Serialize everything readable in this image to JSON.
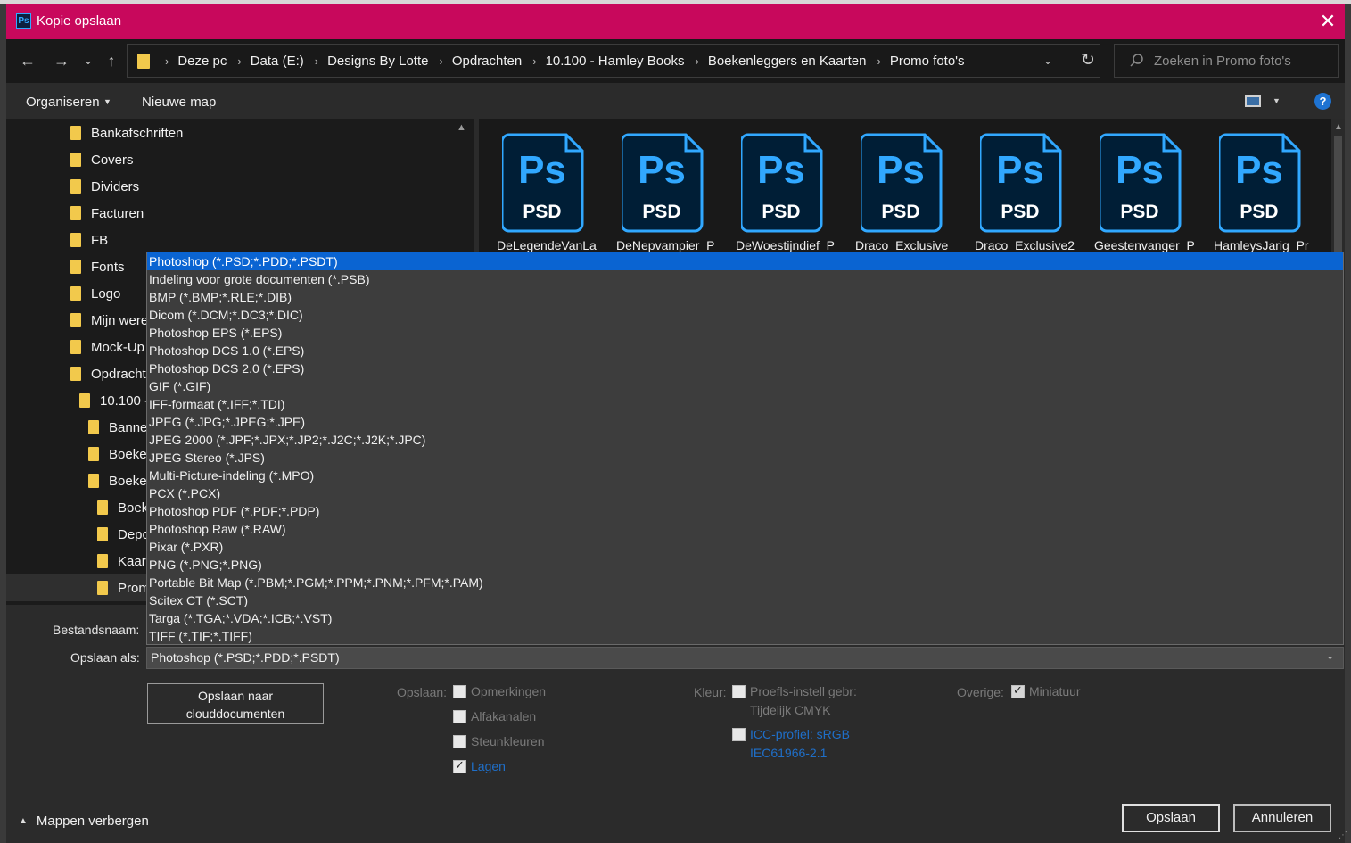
{
  "window": {
    "title": "Kopie opslaan",
    "app_badge": "Ps",
    "close_glyph": "✕"
  },
  "nav": {
    "back_glyph": "←",
    "forward_glyph": "→",
    "recent_glyph": "⌄",
    "up_glyph": "↑",
    "breadcrumbs": [
      "Deze pc",
      "Data (E:)",
      "Designs By Lotte",
      "Opdrachten",
      "10.100 - Hamley Books",
      "Boekenleggers en Kaarten",
      "Promo foto's"
    ],
    "separator": "›",
    "refresh_glyph": "↻",
    "dropdown_glyph": "⌄"
  },
  "search": {
    "placeholder": "Zoeken in Promo foto's"
  },
  "toolbar": {
    "organize_label": "Organiseren",
    "new_folder_label": "Nieuwe map",
    "help_label": "?"
  },
  "sidebar": {
    "items": [
      {
        "label": "Bankafschriften",
        "indent": 0
      },
      {
        "label": "Covers",
        "indent": 0
      },
      {
        "label": "Dividers",
        "indent": 0
      },
      {
        "label": "Facturen",
        "indent": 0
      },
      {
        "label": "FB",
        "indent": 0
      },
      {
        "label": "Fonts",
        "indent": 0
      },
      {
        "label": "Logo",
        "indent": 0
      },
      {
        "label": "Mijn were",
        "indent": 0
      },
      {
        "label": "Mock-Up",
        "indent": 0
      },
      {
        "label": "Opdracht",
        "indent": 0
      },
      {
        "label": "10.100 -",
        "indent": 1
      },
      {
        "label": "Banne",
        "indent": 2
      },
      {
        "label": "Boeke",
        "indent": 2
      },
      {
        "label": "Boeke",
        "indent": 2
      },
      {
        "label": "Boek",
        "indent": 3
      },
      {
        "label": "Depo",
        "indent": 3
      },
      {
        "label": "Kaar",
        "indent": 3
      },
      {
        "label": "Prom",
        "indent": 3,
        "selected": true
      }
    ]
  },
  "files": [
    {
      "name": "DeLegendeVanLa",
      "type_label": "PSD",
      "icon_text": "Ps"
    },
    {
      "name": "DeNepvampier_P",
      "type_label": "PSD",
      "icon_text": "Ps"
    },
    {
      "name": "DeWoestijndief_P",
      "type_label": "PSD",
      "icon_text": "Ps"
    },
    {
      "name": "Draco_Exclusive",
      "type_label": "PSD",
      "icon_text": "Ps"
    },
    {
      "name": "Draco_Exclusive2",
      "type_label": "PSD",
      "icon_text": "Ps"
    },
    {
      "name": "Geestenvanger_P",
      "type_label": "PSD",
      "icon_text": "Ps"
    },
    {
      "name": "HamleysJarig_Pr",
      "type_label": "PSD",
      "icon_text": "Ps"
    }
  ],
  "form": {
    "filename_label": "Bestandsnaam:",
    "saveas_label": "Opslaan als:",
    "saveas_value": "Photoshop (*.PSD;*.PDD;*.PSDT)",
    "format_options": [
      "Photoshop (*.PSD;*.PDD;*.PSDT)",
      "Indeling voor grote documenten (*.PSB)",
      "BMP (*.BMP;*.RLE;*.DIB)",
      "Dicom (*.DCM;*.DC3;*.DIC)",
      "Photoshop EPS (*.EPS)",
      "Photoshop DCS 1.0 (*.EPS)",
      "Photoshop DCS 2.0 (*.EPS)",
      "GIF (*.GIF)",
      "IFF-formaat (*.IFF;*.TDI)",
      "JPEG (*.JPG;*.JPEG;*.JPE)",
      "JPEG 2000 (*.JPF;*.JPX;*.JP2;*.J2C;*.J2K;*.JPC)",
      "JPEG Stereo (*.JPS)",
      "Multi-Picture-indeling (*.MPO)",
      "PCX (*.PCX)",
      "Photoshop PDF (*.PDF;*.PDP)",
      "Photoshop Raw (*.RAW)",
      "Pixar (*.PXR)",
      "PNG (*.PNG;*.PNG)",
      "Portable Bit Map (*.PBM;*.PGM;*.PPM;*.PNM;*.PFM;*.PAM)",
      "Scitex CT (*.SCT)",
      "Targa (*.TGA;*.VDA;*.ICB;*.VST)",
      "TIFF (*.TIF;*.TIFF)"
    ],
    "cloud_button_line1": "Opslaan naar",
    "cloud_button_line2": "clouddocumenten",
    "save_group_label": "Opslaan:",
    "save_options": [
      {
        "label": "Opmerkingen",
        "checked": false,
        "link": false
      },
      {
        "label": "Alfakanalen",
        "checked": false,
        "link": false
      },
      {
        "label": "Steunkleuren",
        "checked": false,
        "link": false
      },
      {
        "label": "Lagen",
        "checked": true,
        "link": true
      }
    ],
    "color_group_label": "Kleur:",
    "proof_line1": "Proefls-instell gebr:",
    "proof_line2": "Tijdelijk CMYK",
    "icc_line1": "ICC-profiel:  sRGB",
    "icc_line2": "IEC61966-2.1",
    "other_group_label": "Overige:",
    "thumbnail_label": "Miniatuur"
  },
  "footer": {
    "hide_folders_label": "Mappen verbergen",
    "save_label": "Opslaan",
    "cancel_label": "Annuleren"
  },
  "colors": {
    "titlebar": "#c8085c",
    "selection": "#0a64d2",
    "ps_blue": "#31a8ff",
    "ps_dark": "#001e36"
  }
}
